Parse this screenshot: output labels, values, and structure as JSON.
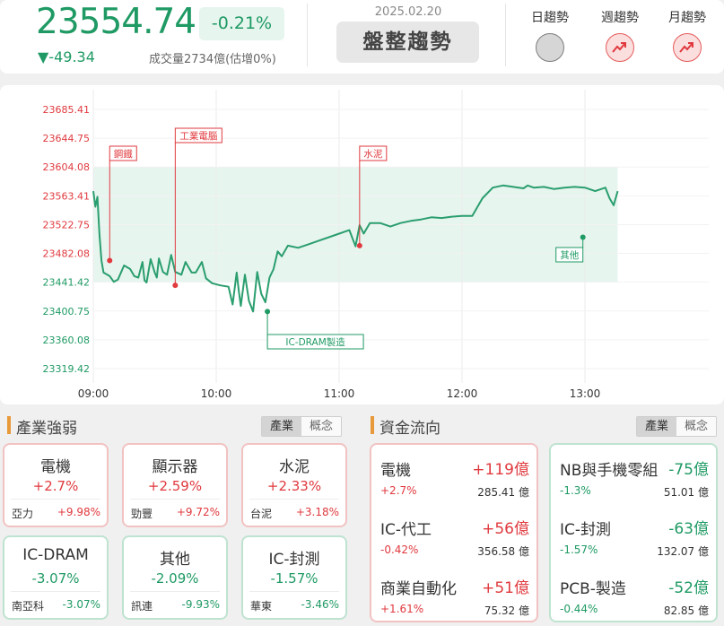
{
  "header": {
    "index_value": "23554.74",
    "change_pct": "-0.21%",
    "change": "▼-49.34",
    "volume": "成交量2734億(估增0%)",
    "date": "2025.02.20",
    "trend_label": "盤整趨勢",
    "trends": [
      {
        "label": "日趨勢",
        "state": "neutral",
        "icon": "neutral-dot-icon"
      },
      {
        "label": "週趨勢",
        "state": "up",
        "icon": "trend-up-icon"
      },
      {
        "label": "月趨勢",
        "state": "up",
        "icon": "trend-up-icon"
      }
    ]
  },
  "chart_data": {
    "type": "line",
    "y_ticks": [
      "23685.41",
      "23644.75",
      "23604.08",
      "23563.41",
      "23522.75",
      "23482.08",
      "23441.42",
      "23400.75",
      "23360.08",
      "23319.42"
    ],
    "y_tick_colors": [
      "#e0393e",
      "#e0393e",
      "#e0393e",
      "#e0393e",
      "#e0393e",
      "#e0393e",
      "#1f9a64",
      "#1f9a64",
      "#1f9a64",
      "#1f9a64"
    ],
    "reference_value": 23604.08,
    "ylim": [
      23319.42,
      23685.41
    ],
    "x_ticks": [
      "09:00",
      "10:00",
      "11:00",
      "12:00",
      "13:00"
    ],
    "x_range_minutes": [
      0,
      270
    ],
    "band": [
      23441.42,
      23604.08
    ],
    "series": [
      {
        "x_minutes": [
          0,
          1,
          2,
          3,
          4,
          5,
          8,
          10,
          12,
          15,
          18,
          20,
          22,
          24,
          25,
          26,
          28,
          30,
          31,
          32,
          34,
          36,
          38,
          40,
          43,
          45,
          48,
          50,
          53,
          55,
          58,
          62,
          66,
          68,
          70,
          71,
          72,
          74,
          76,
          78,
          80,
          82,
          84,
          86,
          88,
          90,
          92,
          95,
          100,
          105,
          110,
          115,
          120,
          125,
          128,
          130,
          132,
          135,
          140,
          145,
          150,
          155,
          160,
          165,
          170,
          175,
          180,
          185,
          190,
          195,
          200,
          205,
          210,
          212,
          215,
          220,
          225,
          230,
          235,
          240,
          245,
          250,
          252,
          254,
          256
        ],
        "values": [
          23570,
          23548,
          23562,
          23510,
          23472,
          23455,
          23450,
          23442,
          23445,
          23465,
          23460,
          23450,
          23448,
          23470,
          23444,
          23441,
          23474,
          23455,
          23448,
          23475,
          23456,
          23452,
          23480,
          23456,
          23452,
          23470,
          23455,
          23455,
          23470,
          23447,
          23440,
          23437,
          23435,
          23410,
          23455,
          23430,
          23408,
          23452,
          23415,
          23400,
          23456,
          23425,
          23413,
          23448,
          23460,
          23485,
          23478,
          23493,
          23490,
          23495,
          23500,
          23505,
          23510,
          23515,
          23492,
          23522,
          23510,
          23525,
          23525,
          23520,
          23525,
          23528,
          23530,
          23533,
          23532,
          23534,
          23535,
          23535,
          23560,
          23575,
          23578,
          23576,
          23574,
          23578,
          23575,
          23576,
          23573,
          23575,
          23576,
          23575,
          23570,
          23575,
          23560,
          23550,
          23570
        ],
        "color": "#2a9e6e"
      }
    ],
    "annotations": [
      {
        "label": "鋼鐵",
        "x_minutes": 8,
        "value": 23472,
        "color": "#e0393e"
      },
      {
        "label": "工業電腦",
        "x_minutes": 40,
        "value": 23437,
        "color": "#e0393e"
      },
      {
        "label": "IC-DRAM製造",
        "x_minutes": 85,
        "value": 23400,
        "color": "#1f9a64"
      },
      {
        "label": "水泥",
        "x_minutes": 130,
        "value": 23493,
        "color": "#e0393e"
      },
      {
        "label": "其他",
        "x_minutes": 239,
        "value": 23505,
        "color": "#1f9a64"
      }
    ]
  },
  "industry": {
    "title": "產業強弱",
    "toggle": [
      "產業",
      "概念"
    ],
    "cards": [
      {
        "name": "電機",
        "pct": "+2.7%",
        "stock": "亞力",
        "stock_pct": "+9.98%",
        "dir": "up"
      },
      {
        "name": "顯示器",
        "pct": "+2.59%",
        "stock": "勁豐",
        "stock_pct": "+9.72%",
        "dir": "up"
      },
      {
        "name": "水泥",
        "pct": "+2.33%",
        "stock": "台泥",
        "stock_pct": "+3.18%",
        "dir": "up"
      },
      {
        "name": "IC-DRAM",
        "pct": "-3.07%",
        "stock": "南亞科",
        "stock_pct": "-3.07%",
        "dir": "down"
      },
      {
        "name": "其他",
        "pct": "-2.09%",
        "stock": "訊連",
        "stock_pct": "-9.93%",
        "dir": "down"
      },
      {
        "name": "IC-封測",
        "pct": "-1.57%",
        "stock": "華東",
        "stock_pct": "-3.46%",
        "dir": "down"
      }
    ]
  },
  "fund_flow": {
    "title": "資金流向",
    "toggle": [
      "產業",
      "概念"
    ],
    "inflow": [
      {
        "name": "電機",
        "amount": "+119億",
        "pct": "+2.7%",
        "volume": "285.41 億"
      },
      {
        "name": "IC-代工",
        "amount": "+56億",
        "pct": "-0.42%",
        "volume": "356.58 億"
      },
      {
        "name": "商業自動化",
        "amount": "+51億",
        "pct": "+1.61%",
        "volume": "75.32 億"
      }
    ],
    "outflow": [
      {
        "name": "NB與手機零組",
        "amount": "-75億",
        "pct": "-1.3%",
        "volume": "51.01 億"
      },
      {
        "name": "IC-封測",
        "amount": "-63億",
        "pct": "-1.57%",
        "volume": "132.07 億"
      },
      {
        "name": "PCB-製造",
        "amount": "-52億",
        "pct": "-0.44%",
        "volume": "82.85 億"
      }
    ]
  }
}
